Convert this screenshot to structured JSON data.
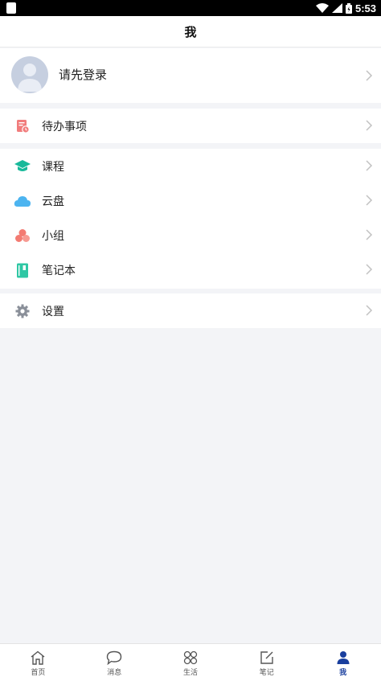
{
  "status_bar": {
    "time": "5:53"
  },
  "header": {
    "title": "我"
  },
  "profile": {
    "login_prompt": "请先登录"
  },
  "menu": {
    "todo": {
      "label": "待办事项",
      "icon": "todo-icon"
    },
    "items": [
      {
        "label": "课程",
        "icon": "course-icon"
      },
      {
        "label": "云盘",
        "icon": "cloud-icon"
      },
      {
        "label": "小组",
        "icon": "group-icon"
      },
      {
        "label": "笔记本",
        "icon": "notebook-icon"
      }
    ],
    "settings": {
      "label": "设置",
      "icon": "gear-icon"
    }
  },
  "tabbar": {
    "tabs": [
      {
        "label": "首页",
        "icon": "home-icon"
      },
      {
        "label": "消息",
        "icon": "message-icon"
      },
      {
        "label": "生活",
        "icon": "life-icon"
      },
      {
        "label": "笔记",
        "icon": "note-icon"
      },
      {
        "label": "我",
        "icon": "person-icon",
        "active": true
      }
    ]
  },
  "colors": {
    "accent": "#1a3f9e",
    "background": "#f3f4f7"
  }
}
